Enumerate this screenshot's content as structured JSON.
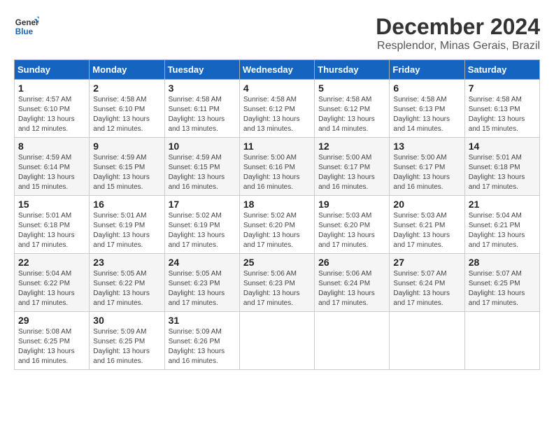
{
  "logo": {
    "line1": "General",
    "line2": "Blue"
  },
  "title": {
    "month": "December 2024",
    "location": "Resplendor, Minas Gerais, Brazil"
  },
  "headers": [
    "Sunday",
    "Monday",
    "Tuesday",
    "Wednesday",
    "Thursday",
    "Friday",
    "Saturday"
  ],
  "weeks": [
    [
      {
        "day": "1",
        "sunrise": "Sunrise: 4:57 AM",
        "sunset": "Sunset: 6:10 PM",
        "daylight": "Daylight: 13 hours and 12 minutes."
      },
      {
        "day": "2",
        "sunrise": "Sunrise: 4:58 AM",
        "sunset": "Sunset: 6:10 PM",
        "daylight": "Daylight: 13 hours and 12 minutes."
      },
      {
        "day": "3",
        "sunrise": "Sunrise: 4:58 AM",
        "sunset": "Sunset: 6:11 PM",
        "daylight": "Daylight: 13 hours and 13 minutes."
      },
      {
        "day": "4",
        "sunrise": "Sunrise: 4:58 AM",
        "sunset": "Sunset: 6:12 PM",
        "daylight": "Daylight: 13 hours and 13 minutes."
      },
      {
        "day": "5",
        "sunrise": "Sunrise: 4:58 AM",
        "sunset": "Sunset: 6:12 PM",
        "daylight": "Daylight: 13 hours and 14 minutes."
      },
      {
        "day": "6",
        "sunrise": "Sunrise: 4:58 AM",
        "sunset": "Sunset: 6:13 PM",
        "daylight": "Daylight: 13 hours and 14 minutes."
      },
      {
        "day": "7",
        "sunrise": "Sunrise: 4:58 AM",
        "sunset": "Sunset: 6:13 PM",
        "daylight": "Daylight: 13 hours and 15 minutes."
      }
    ],
    [
      {
        "day": "8",
        "sunrise": "Sunrise: 4:59 AM",
        "sunset": "Sunset: 6:14 PM",
        "daylight": "Daylight: 13 hours and 15 minutes."
      },
      {
        "day": "9",
        "sunrise": "Sunrise: 4:59 AM",
        "sunset": "Sunset: 6:15 PM",
        "daylight": "Daylight: 13 hours and 15 minutes."
      },
      {
        "day": "10",
        "sunrise": "Sunrise: 4:59 AM",
        "sunset": "Sunset: 6:15 PM",
        "daylight": "Daylight: 13 hours and 16 minutes."
      },
      {
        "day": "11",
        "sunrise": "Sunrise: 5:00 AM",
        "sunset": "Sunset: 6:16 PM",
        "daylight": "Daylight: 13 hours and 16 minutes."
      },
      {
        "day": "12",
        "sunrise": "Sunrise: 5:00 AM",
        "sunset": "Sunset: 6:17 PM",
        "daylight": "Daylight: 13 hours and 16 minutes."
      },
      {
        "day": "13",
        "sunrise": "Sunrise: 5:00 AM",
        "sunset": "Sunset: 6:17 PM",
        "daylight": "Daylight: 13 hours and 16 minutes."
      },
      {
        "day": "14",
        "sunrise": "Sunrise: 5:01 AM",
        "sunset": "Sunset: 6:18 PM",
        "daylight": "Daylight: 13 hours and 17 minutes."
      }
    ],
    [
      {
        "day": "15",
        "sunrise": "Sunrise: 5:01 AM",
        "sunset": "Sunset: 6:18 PM",
        "daylight": "Daylight: 13 hours and 17 minutes."
      },
      {
        "day": "16",
        "sunrise": "Sunrise: 5:01 AM",
        "sunset": "Sunset: 6:19 PM",
        "daylight": "Daylight: 13 hours and 17 minutes."
      },
      {
        "day": "17",
        "sunrise": "Sunrise: 5:02 AM",
        "sunset": "Sunset: 6:19 PM",
        "daylight": "Daylight: 13 hours and 17 minutes."
      },
      {
        "day": "18",
        "sunrise": "Sunrise: 5:02 AM",
        "sunset": "Sunset: 6:20 PM",
        "daylight": "Daylight: 13 hours and 17 minutes."
      },
      {
        "day": "19",
        "sunrise": "Sunrise: 5:03 AM",
        "sunset": "Sunset: 6:20 PM",
        "daylight": "Daylight: 13 hours and 17 minutes."
      },
      {
        "day": "20",
        "sunrise": "Sunrise: 5:03 AM",
        "sunset": "Sunset: 6:21 PM",
        "daylight": "Daylight: 13 hours and 17 minutes."
      },
      {
        "day": "21",
        "sunrise": "Sunrise: 5:04 AM",
        "sunset": "Sunset: 6:21 PM",
        "daylight": "Daylight: 13 hours and 17 minutes."
      }
    ],
    [
      {
        "day": "22",
        "sunrise": "Sunrise: 5:04 AM",
        "sunset": "Sunset: 6:22 PM",
        "daylight": "Daylight: 13 hours and 17 minutes."
      },
      {
        "day": "23",
        "sunrise": "Sunrise: 5:05 AM",
        "sunset": "Sunset: 6:22 PM",
        "daylight": "Daylight: 13 hours and 17 minutes."
      },
      {
        "day": "24",
        "sunrise": "Sunrise: 5:05 AM",
        "sunset": "Sunset: 6:23 PM",
        "daylight": "Daylight: 13 hours and 17 minutes."
      },
      {
        "day": "25",
        "sunrise": "Sunrise: 5:06 AM",
        "sunset": "Sunset: 6:23 PM",
        "daylight": "Daylight: 13 hours and 17 minutes."
      },
      {
        "day": "26",
        "sunrise": "Sunrise: 5:06 AM",
        "sunset": "Sunset: 6:24 PM",
        "daylight": "Daylight: 13 hours and 17 minutes."
      },
      {
        "day": "27",
        "sunrise": "Sunrise: 5:07 AM",
        "sunset": "Sunset: 6:24 PM",
        "daylight": "Daylight: 13 hours and 17 minutes."
      },
      {
        "day": "28",
        "sunrise": "Sunrise: 5:07 AM",
        "sunset": "Sunset: 6:25 PM",
        "daylight": "Daylight: 13 hours and 17 minutes."
      }
    ],
    [
      {
        "day": "29",
        "sunrise": "Sunrise: 5:08 AM",
        "sunset": "Sunset: 6:25 PM",
        "daylight": "Daylight: 13 hours and 16 minutes."
      },
      {
        "day": "30",
        "sunrise": "Sunrise: 5:09 AM",
        "sunset": "Sunset: 6:25 PM",
        "daylight": "Daylight: 13 hours and 16 minutes."
      },
      {
        "day": "31",
        "sunrise": "Sunrise: 5:09 AM",
        "sunset": "Sunset: 6:26 PM",
        "daylight": "Daylight: 13 hours and 16 minutes."
      },
      null,
      null,
      null,
      null
    ]
  ]
}
